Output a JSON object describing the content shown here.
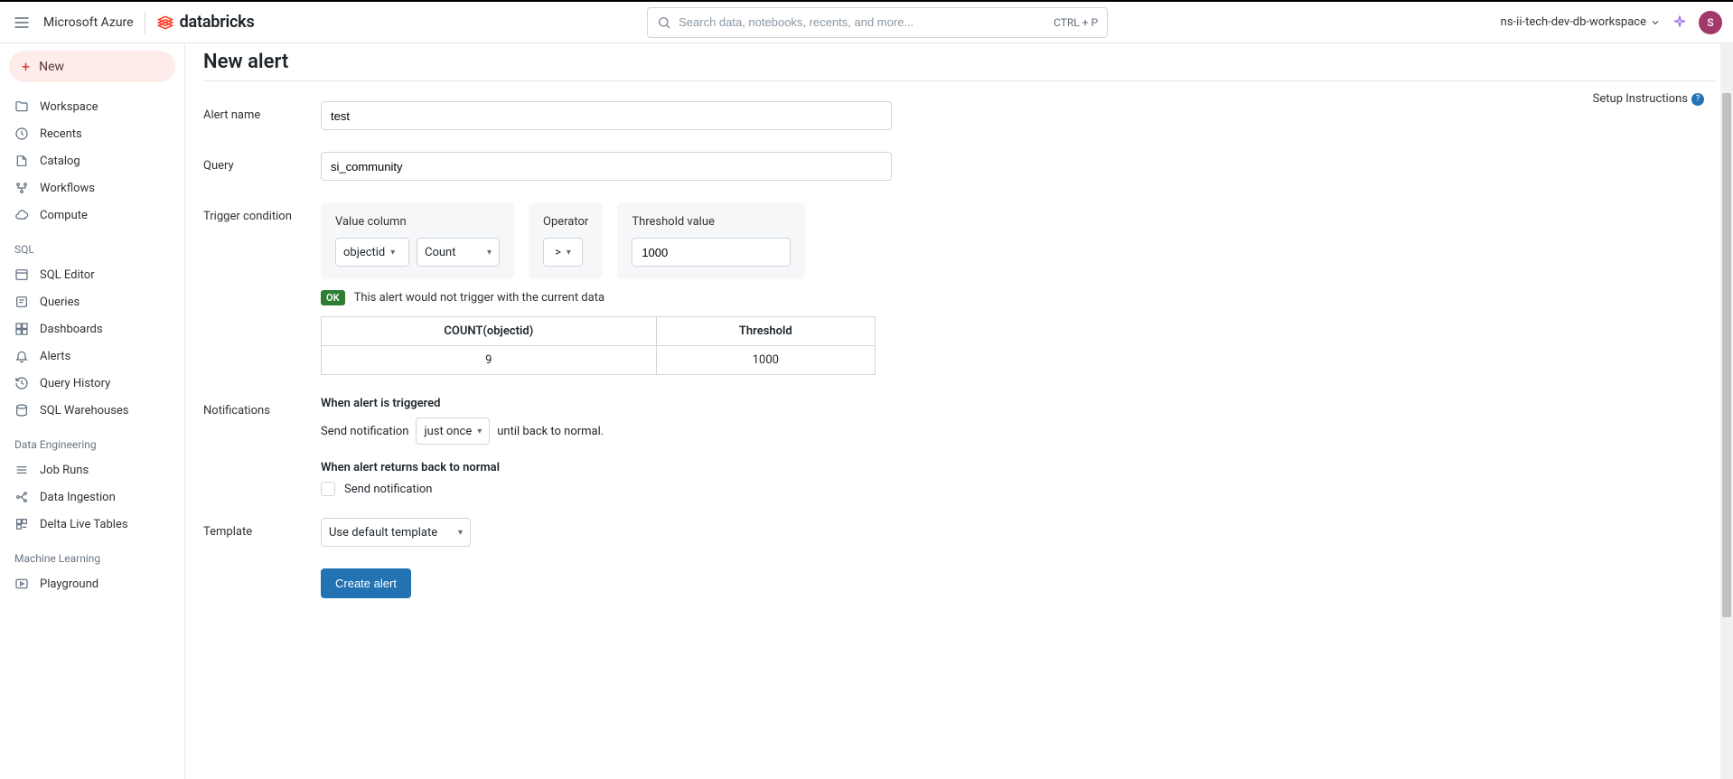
{
  "header": {
    "azure": "Microsoft Azure",
    "dbBrand": "databricks",
    "searchPlaceholder": "Search data, notebooks, recents, and more...",
    "shortcut": "CTRL + P",
    "workspace": "ns-ii-tech-dev-db-workspace",
    "avatarInitial": "S"
  },
  "sidebar": {
    "newLabel": "New",
    "groups": {
      "top": [
        {
          "label": "Workspace"
        },
        {
          "label": "Recents"
        },
        {
          "label": "Catalog"
        },
        {
          "label": "Workflows"
        },
        {
          "label": "Compute"
        }
      ],
      "sql": {
        "title": "SQL",
        "items": [
          {
            "label": "SQL Editor"
          },
          {
            "label": "Queries"
          },
          {
            "label": "Dashboards"
          },
          {
            "label": "Alerts"
          },
          {
            "label": "Query History"
          },
          {
            "label": "SQL Warehouses"
          }
        ]
      },
      "de": {
        "title": "Data Engineering",
        "items": [
          {
            "label": "Job Runs"
          },
          {
            "label": "Data Ingestion"
          },
          {
            "label": "Delta Live Tables"
          }
        ]
      },
      "ml": {
        "title": "Machine Learning",
        "items": [
          {
            "label": "Playground"
          }
        ]
      }
    }
  },
  "page": {
    "title": "New alert",
    "setupLink": "Setup Instructions",
    "labels": {
      "alertName": "Alert name",
      "query": "Query",
      "trigger": "Trigger condition",
      "notifications": "Notifications",
      "template": "Template"
    },
    "alertNameValue": "test",
    "queryValue": "si_community",
    "trigger": {
      "valueColumnLabel": "Value column",
      "valueColumnSelected": "objectid",
      "aggSelected": "Count",
      "operatorLabel": "Operator",
      "operatorSelected": ">",
      "thresholdLabel": "Threshold value",
      "thresholdValue": "1000",
      "statusBadge": "OK",
      "statusText": "This alert would not trigger with the current data",
      "table": {
        "col1": "COUNT(objectid)",
        "col2": "Threshold",
        "val1": "9",
        "val2": "1000"
      }
    },
    "notifications": {
      "triggeredHeading": "When alert is triggered",
      "sendPrefix": "Send notification",
      "freqSelected": "just once",
      "sendSuffix": "until back to normal.",
      "normalHeading": "When alert returns back to normal",
      "normalCheckboxLabel": "Send notification"
    },
    "template": {
      "selected": "Use default template"
    },
    "createBtn": "Create alert"
  }
}
